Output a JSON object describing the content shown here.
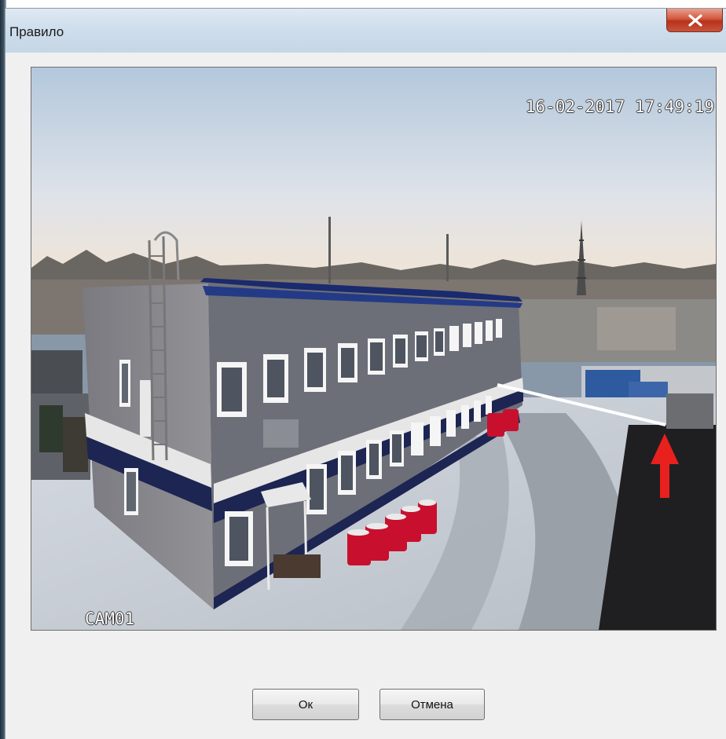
{
  "window": {
    "title": "Правило",
    "close_icon": "close-x-icon"
  },
  "camera": {
    "timestamp": "16-02-2017 17:49:19",
    "camera_name": "CAM01"
  },
  "rule": {
    "line_color": "#ffffff",
    "arrow_color": "#e8201e"
  },
  "buttons": {
    "ok_label": "Ок",
    "cancel_label": "Отмена"
  },
  "colors": {
    "close_button": "#c9533b",
    "titlebar": "#cfdeec"
  }
}
